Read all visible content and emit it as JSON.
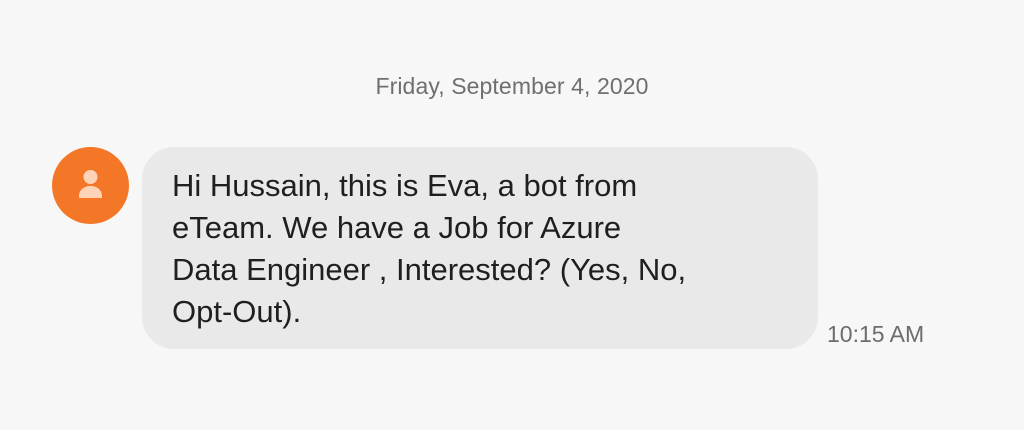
{
  "conversation": {
    "date_header": "Friday, September 4, 2020",
    "message": {
      "avatar_icon": "person-icon",
      "text": "Hi Hussain, this is Eva, a bot from\neTeam. We have a Job for Azure\nData Engineer , Interested? (Yes, No,\nOpt-Out).",
      "time": "10:15 AM"
    }
  },
  "colors": {
    "background": "#f7f7f7",
    "bubble": "#e9e9e9",
    "avatar": "#f47727",
    "text": "#1f1f1f",
    "meta_text": "#6f6f6f"
  }
}
